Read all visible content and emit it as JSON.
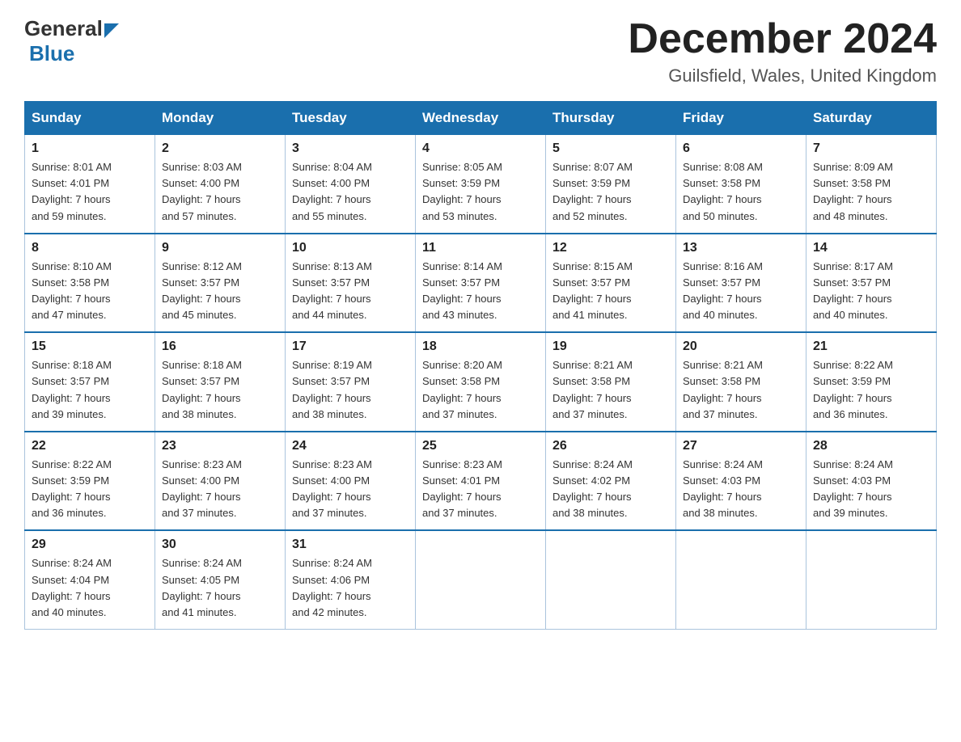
{
  "header": {
    "logo_general": "General",
    "logo_blue": "Blue",
    "month_title": "December 2024",
    "location": "Guilsfield, Wales, United Kingdom"
  },
  "weekdays": [
    "Sunday",
    "Monday",
    "Tuesday",
    "Wednesday",
    "Thursday",
    "Friday",
    "Saturday"
  ],
  "weeks": [
    [
      {
        "day": "1",
        "sunrise": "8:01 AM",
        "sunset": "4:01 PM",
        "daylight": "7 hours and 59 minutes."
      },
      {
        "day": "2",
        "sunrise": "8:03 AM",
        "sunset": "4:00 PM",
        "daylight": "7 hours and 57 minutes."
      },
      {
        "day": "3",
        "sunrise": "8:04 AM",
        "sunset": "4:00 PM",
        "daylight": "7 hours and 55 minutes."
      },
      {
        "day": "4",
        "sunrise": "8:05 AM",
        "sunset": "3:59 PM",
        "daylight": "7 hours and 53 minutes."
      },
      {
        "day": "5",
        "sunrise": "8:07 AM",
        "sunset": "3:59 PM",
        "daylight": "7 hours and 52 minutes."
      },
      {
        "day": "6",
        "sunrise": "8:08 AM",
        "sunset": "3:58 PM",
        "daylight": "7 hours and 50 minutes."
      },
      {
        "day": "7",
        "sunrise": "8:09 AM",
        "sunset": "3:58 PM",
        "daylight": "7 hours and 48 minutes."
      }
    ],
    [
      {
        "day": "8",
        "sunrise": "8:10 AM",
        "sunset": "3:58 PM",
        "daylight": "7 hours and 47 minutes."
      },
      {
        "day": "9",
        "sunrise": "8:12 AM",
        "sunset": "3:57 PM",
        "daylight": "7 hours and 45 minutes."
      },
      {
        "day": "10",
        "sunrise": "8:13 AM",
        "sunset": "3:57 PM",
        "daylight": "7 hours and 44 minutes."
      },
      {
        "day": "11",
        "sunrise": "8:14 AM",
        "sunset": "3:57 PM",
        "daylight": "7 hours and 43 minutes."
      },
      {
        "day": "12",
        "sunrise": "8:15 AM",
        "sunset": "3:57 PM",
        "daylight": "7 hours and 41 minutes."
      },
      {
        "day": "13",
        "sunrise": "8:16 AM",
        "sunset": "3:57 PM",
        "daylight": "7 hours and 40 minutes."
      },
      {
        "day": "14",
        "sunrise": "8:17 AM",
        "sunset": "3:57 PM",
        "daylight": "7 hours and 40 minutes."
      }
    ],
    [
      {
        "day": "15",
        "sunrise": "8:18 AM",
        "sunset": "3:57 PM",
        "daylight": "7 hours and 39 minutes."
      },
      {
        "day": "16",
        "sunrise": "8:18 AM",
        "sunset": "3:57 PM",
        "daylight": "7 hours and 38 minutes."
      },
      {
        "day": "17",
        "sunrise": "8:19 AM",
        "sunset": "3:57 PM",
        "daylight": "7 hours and 38 minutes."
      },
      {
        "day": "18",
        "sunrise": "8:20 AM",
        "sunset": "3:58 PM",
        "daylight": "7 hours and 37 minutes."
      },
      {
        "day": "19",
        "sunrise": "8:21 AM",
        "sunset": "3:58 PM",
        "daylight": "7 hours and 37 minutes."
      },
      {
        "day": "20",
        "sunrise": "8:21 AM",
        "sunset": "3:58 PM",
        "daylight": "7 hours and 37 minutes."
      },
      {
        "day": "21",
        "sunrise": "8:22 AM",
        "sunset": "3:59 PM",
        "daylight": "7 hours and 36 minutes."
      }
    ],
    [
      {
        "day": "22",
        "sunrise": "8:22 AM",
        "sunset": "3:59 PM",
        "daylight": "7 hours and 36 minutes."
      },
      {
        "day": "23",
        "sunrise": "8:23 AM",
        "sunset": "4:00 PM",
        "daylight": "7 hours and 37 minutes."
      },
      {
        "day": "24",
        "sunrise": "8:23 AM",
        "sunset": "4:00 PM",
        "daylight": "7 hours and 37 minutes."
      },
      {
        "day": "25",
        "sunrise": "8:23 AM",
        "sunset": "4:01 PM",
        "daylight": "7 hours and 37 minutes."
      },
      {
        "day": "26",
        "sunrise": "8:24 AM",
        "sunset": "4:02 PM",
        "daylight": "7 hours and 38 minutes."
      },
      {
        "day": "27",
        "sunrise": "8:24 AM",
        "sunset": "4:03 PM",
        "daylight": "7 hours and 38 minutes."
      },
      {
        "day": "28",
        "sunrise": "8:24 AM",
        "sunset": "4:03 PM",
        "daylight": "7 hours and 39 minutes."
      }
    ],
    [
      {
        "day": "29",
        "sunrise": "8:24 AM",
        "sunset": "4:04 PM",
        "daylight": "7 hours and 40 minutes."
      },
      {
        "day": "30",
        "sunrise": "8:24 AM",
        "sunset": "4:05 PM",
        "daylight": "7 hours and 41 minutes."
      },
      {
        "day": "31",
        "sunrise": "8:24 AM",
        "sunset": "4:06 PM",
        "daylight": "7 hours and 42 minutes."
      },
      null,
      null,
      null,
      null
    ]
  ],
  "labels": {
    "sunrise": "Sunrise:",
    "sunset": "Sunset:",
    "daylight": "Daylight:"
  }
}
